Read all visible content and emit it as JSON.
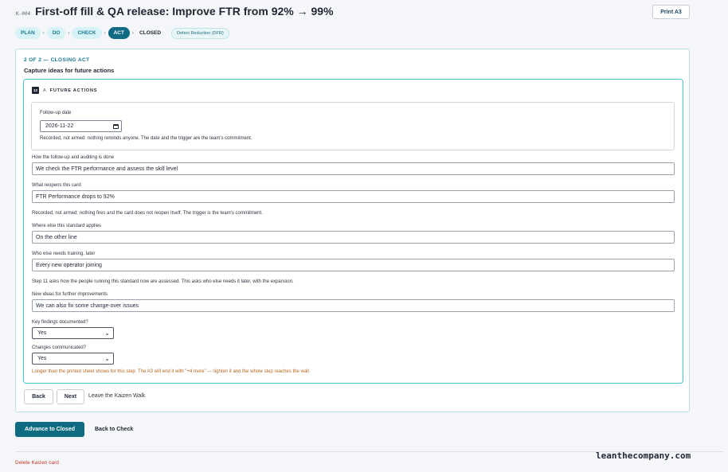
{
  "header": {
    "card_id": "K-004",
    "title": "First-off fill & QA release: Improve FTR from 92% → 99%",
    "print_label": "Print A3"
  },
  "stepper": {
    "stages": [
      "PLAN",
      "DO",
      "CHECK",
      "ACT",
      "CLOSED"
    ],
    "active": "ACT",
    "tag": "Defect Reduction (DFR)"
  },
  "panel": {
    "kicker": "2 OF 2 — CLOSING ACT",
    "subtitle": "Capture ideas for future actions",
    "section": {
      "number": "12",
      "letter": "A",
      "title": "FUTURE ACTIONS"
    },
    "followup": {
      "label": "Follow-up date",
      "value": "2026-11-22",
      "note": "Recorded, not armed: nothing reminds anyone. The date and the trigger are the team's commitment."
    },
    "fields": {
      "auditing_label": "How the follow-up and auditing is done",
      "auditing_value": "We check the FTR performance and assess the skill level",
      "reopens_label": "What reopens this card",
      "reopens_value": "FTR Performance drops to 92%",
      "reopens_note": "Recorded, not armed: nothing fires and the card does not reopen itself. The trigger is the team's commitment.",
      "where_label": "Where else this standard applies",
      "where_value": "On the other line",
      "who_label": "Who else needs training, later",
      "who_value": "Every new operator joining",
      "who_note": "Step 11 asks how the people running this standard now are assessed. This asks who else needs it later, with the expansion.",
      "ideas_label": "New ideas for further improvements",
      "ideas_value": "We can also fix some change-over issues",
      "findings_label": "Key findings documented?",
      "findings_value": "Yes",
      "changes_label": "Changes communicated?",
      "changes_value": "Yes",
      "warning": "Longer than the printed sheet shows for this step. The A3 will end it with \"+4 more\" — tighten it and the whole step reaches the wall."
    },
    "nav": {
      "back": "Back",
      "next": "Next",
      "leave": "Leave the Kaizen Walk"
    }
  },
  "footer": {
    "advance": "Advance to Closed",
    "back_to_check": "Back to Check",
    "delete": "Delete Kaizen card",
    "brand": "leanthecompany.com"
  }
}
